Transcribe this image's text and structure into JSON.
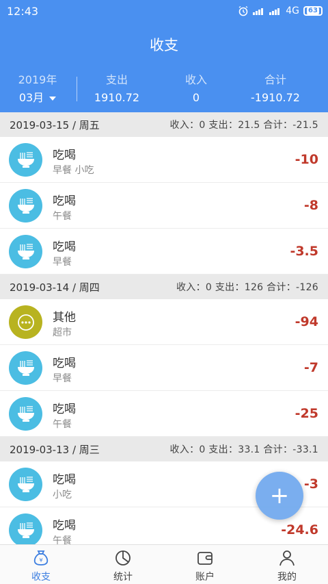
{
  "status": {
    "time": "12:43",
    "network": "4G",
    "battery": "63"
  },
  "header": {
    "title": "收支"
  },
  "summary": {
    "year": "2019年",
    "month": "03月",
    "expense_label": "支出",
    "expense_value": "1910.72",
    "income_label": "收入",
    "income_value": "0",
    "total_label": "合计",
    "total_value": "-1910.72"
  },
  "colors": {
    "primary": "#4a90f0",
    "expense_red": "#c0392b",
    "food_icon": "#4bbde3",
    "other_icon": "#b8b320"
  },
  "days": [
    {
      "date": "2019-03-15 / 周五",
      "totals": "收入：0  支出：21.5  合计：-21.5",
      "items": [
        {
          "category": "吃喝",
          "note": "早餐 小吃",
          "amount": "-10",
          "icon": "noodle-bowl-icon"
        },
        {
          "category": "吃喝",
          "note": "午餐",
          "amount": "-8",
          "icon": "noodle-bowl-icon"
        },
        {
          "category": "吃喝",
          "note": "早餐",
          "amount": "-3.5",
          "icon": "noodle-bowl-icon"
        }
      ]
    },
    {
      "date": "2019-03-14 / 周四",
      "totals": "收入：0  支出：126  合计：-126",
      "items": [
        {
          "category": "其他",
          "note": "超市",
          "amount": "-94",
          "icon": "more-dots-icon"
        },
        {
          "category": "吃喝",
          "note": "早餐",
          "amount": "-7",
          "icon": "noodle-bowl-icon"
        },
        {
          "category": "吃喝",
          "note": "午餐",
          "amount": "-25",
          "icon": "noodle-bowl-icon"
        }
      ]
    },
    {
      "date": "2019-03-13 / 周三",
      "totals": "收入：0  支出：33.1  合计：-33.1",
      "items": [
        {
          "category": "吃喝",
          "note": "小吃",
          "amount": "-3",
          "icon": "noodle-bowl-icon"
        },
        {
          "category": "吃喝",
          "note": "午餐",
          "amount": "-24.6",
          "icon": "noodle-bowl-icon"
        }
      ]
    }
  ],
  "fab": {
    "label": "+"
  },
  "tabs": [
    {
      "label": "收支",
      "icon": "money-bag-icon"
    },
    {
      "label": "统计",
      "icon": "pie-chart-icon"
    },
    {
      "label": "账户",
      "icon": "wallet-icon"
    },
    {
      "label": "我的",
      "icon": "person-icon"
    }
  ]
}
